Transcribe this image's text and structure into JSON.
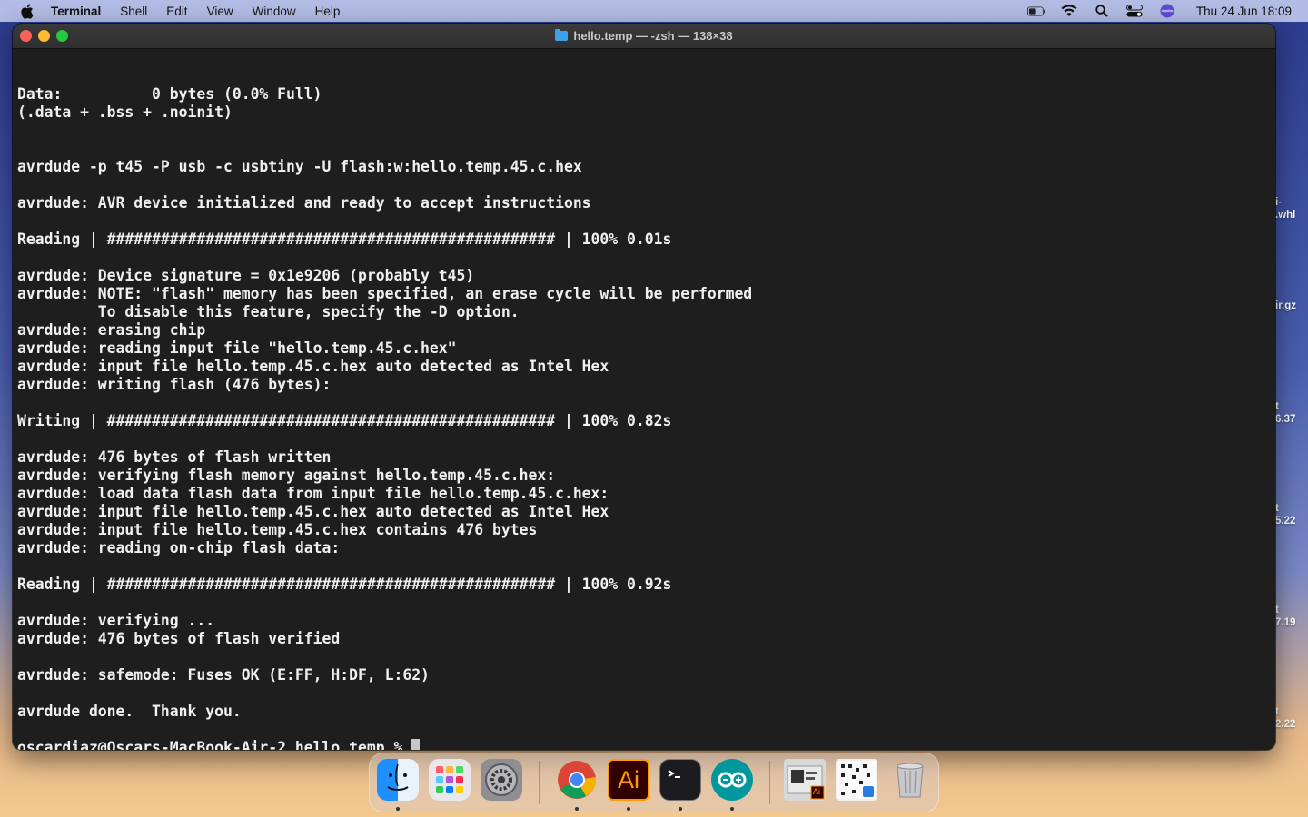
{
  "menubar": {
    "app_name": "Terminal",
    "items": [
      "Shell",
      "Edit",
      "View",
      "Window",
      "Help"
    ],
    "datetime": "Thu 24 Jun  18:09",
    "icons": [
      "apple-icon",
      "battery-icon",
      "wifi-icon",
      "spotlight-icon",
      "control-center-icon",
      "siri-icon"
    ]
  },
  "window": {
    "title": "hello.temp — -zsh — 138×38"
  },
  "terminal": {
    "lines": [
      "",
      "Data:          0 bytes (0.0% Full)",
      "(.data + .bss + .noinit)",
      "",
      "",
      "avrdude -p t45 -P usb -c usbtiny -U flash:w:hello.temp.45.c.hex",
      "",
      "avrdude: AVR device initialized and ready to accept instructions",
      "",
      "Reading | ################################################## | 100% 0.01s",
      "",
      "avrdude: Device signature = 0x1e9206 (probably t45)",
      "avrdude: NOTE: \"flash\" memory has been specified, an erase cycle will be performed",
      "         To disable this feature, specify the -D option.",
      "avrdude: erasing chip",
      "avrdude: reading input file \"hello.temp.45.c.hex\"",
      "avrdude: input file hello.temp.45.c.hex auto detected as Intel Hex",
      "avrdude: writing flash (476 bytes):",
      "",
      "Writing | ################################################## | 100% 0.82s",
      "",
      "avrdude: 476 bytes of flash written",
      "avrdude: verifying flash memory against hello.temp.45.c.hex:",
      "avrdude: load data flash data from input file hello.temp.45.c.hex:",
      "avrdude: input file hello.temp.45.c.hex auto detected as Intel Hex",
      "avrdude: input file hello.temp.45.c.hex contains 476 bytes",
      "avrdude: reading on-chip flash data:",
      "",
      "Reading | ################################################## | 100% 0.92s",
      "",
      "avrdude: verifying ...",
      "avrdude: 476 bytes of flash verified",
      "",
      "avrdude: safemode: Fuses OK (E:FF, H:DF, L:62)",
      "",
      "avrdude done.  Thank you.",
      ""
    ],
    "prompt": "oscardiaz@Oscars-MacBook-Air-2 hello.temp % "
  },
  "desktop": {
    "labels": [
      {
        "l1": "i-",
        "l2": ".whl"
      },
      {
        "l1": "",
        "l2": "ir.gz"
      },
      {
        "l1": "t",
        "l2": "6.37"
      },
      {
        "l1": "t",
        "l2": "5.22"
      },
      {
        "l1": "t",
        "l2": "7.19"
      },
      {
        "l1": "t",
        "l2": "2.22"
      }
    ]
  },
  "dock": {
    "apps": [
      {
        "name": "Finder",
        "icon": "finder-icon",
        "running": true
      },
      {
        "name": "Launchpad",
        "icon": "launchpad-icon",
        "running": false
      },
      {
        "name": "System Preferences",
        "icon": "settings-icon",
        "running": false
      },
      {
        "name": "Google Chrome",
        "icon": "chrome-icon",
        "running": true
      },
      {
        "name": "Adobe Illustrator",
        "icon": "illustrator-icon",
        "label": "Ai",
        "running": true
      },
      {
        "name": "Terminal",
        "icon": "terminal-icon",
        "running": true
      },
      {
        "name": "Arduino",
        "icon": "arduino-icon",
        "running": true
      },
      {
        "name": "Illustrator document",
        "icon": "illustrator-doc-icon",
        "label": "Ai",
        "running": false
      },
      {
        "name": "Downloads stack",
        "icon": "downloads-stack-icon",
        "running": false
      },
      {
        "name": "Trash",
        "icon": "trash-icon",
        "running": false
      }
    ]
  }
}
